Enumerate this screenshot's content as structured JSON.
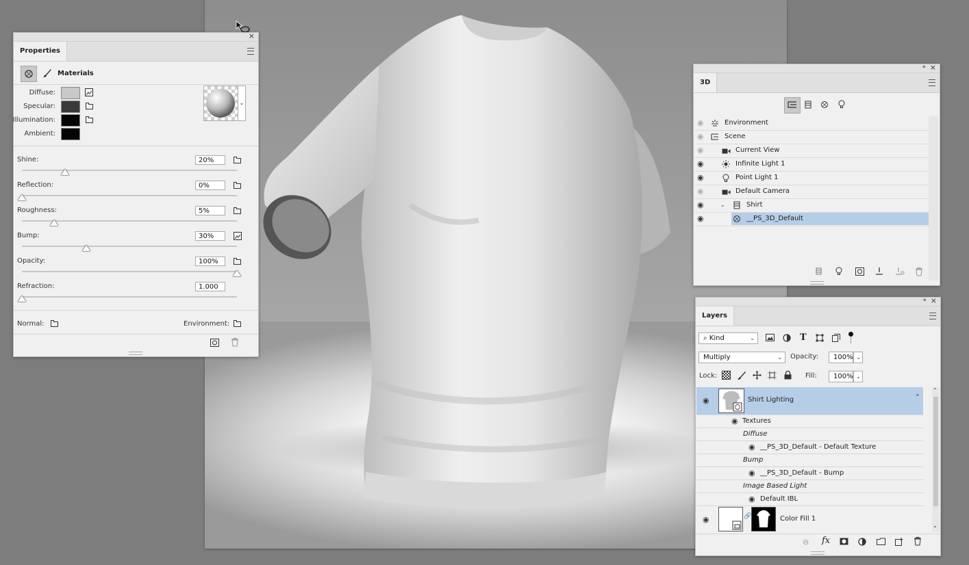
{
  "properties": {
    "tab": "Properties",
    "section": "Materials",
    "diffuse_label": "Diffuse:",
    "specular_label": "Specular:",
    "illumination_label": "Illumination:",
    "ambient_label": "Ambient:",
    "colors": {
      "diffuse": "#c8c8c8",
      "specular": "#3a3a3a",
      "illumination": "#050505",
      "ambient": "#050505"
    },
    "sliders": [
      {
        "label": "Shine:",
        "value": "20%",
        "fraction": 0.2
      },
      {
        "label": "Reflection:",
        "value": "0%",
        "fraction": 0.0
      },
      {
        "label": "Roughness:",
        "value": "5%",
        "fraction": 0.15
      },
      {
        "label": "Bump:",
        "value": "30%",
        "fraction": 0.3
      },
      {
        "label": "Opacity:",
        "value": "100%",
        "fraction": 1.0
      },
      {
        "label": "Refraction:",
        "value": "1.000",
        "fraction": 0.0
      }
    ],
    "normal_label": "Normal:",
    "environment_label": "Environment:"
  },
  "panel3d": {
    "tab": "3D",
    "items": [
      {
        "name": "Environment",
        "icon": "environment-icon",
        "visible": false,
        "indent": 0
      },
      {
        "name": "Scene",
        "icon": "scene-icon",
        "visible": false,
        "indent": 0
      },
      {
        "name": "Current View",
        "icon": "camera-icon",
        "visible": false,
        "indent": 1
      },
      {
        "name": "Infinite Light 1",
        "icon": "sun-light-icon",
        "visible": true,
        "indent": 1
      },
      {
        "name": "Point Light 1",
        "icon": "bulb-icon",
        "visible": true,
        "indent": 1
      },
      {
        "name": "Default Camera",
        "icon": "camera-icon",
        "visible": false,
        "indent": 1
      },
      {
        "name": "Shirt",
        "icon": "mesh-icon",
        "visible": true,
        "indent": 1
      },
      {
        "name": "__PS_3D_Default",
        "icon": "material-icon",
        "visible": true,
        "indent": 2,
        "selected": true
      }
    ]
  },
  "layers": {
    "tab": "Layers",
    "filter_kind": "Kind",
    "blend_mode": "Multiply",
    "opacity_label": "Opacity:",
    "opacity_value": "100%",
    "lock_label": "Lock:",
    "fill_label": "Fill:",
    "fill_value": "100%",
    "shirt_layer": "Shirt Lighting",
    "textures_label": "Textures",
    "diffuse_group": "Diffuse",
    "diffuse_texture": "__PS_3D_Default - Default Texture",
    "bump_group": "Bump",
    "bump_texture": "__PS_3D_Default - Bump",
    "ibl_group": "Image Based Light",
    "ibl_texture": "Default IBL",
    "color_fill_layer": "Color Fill 1",
    "colors": {
      "selection": "#b6cde8"
    }
  }
}
